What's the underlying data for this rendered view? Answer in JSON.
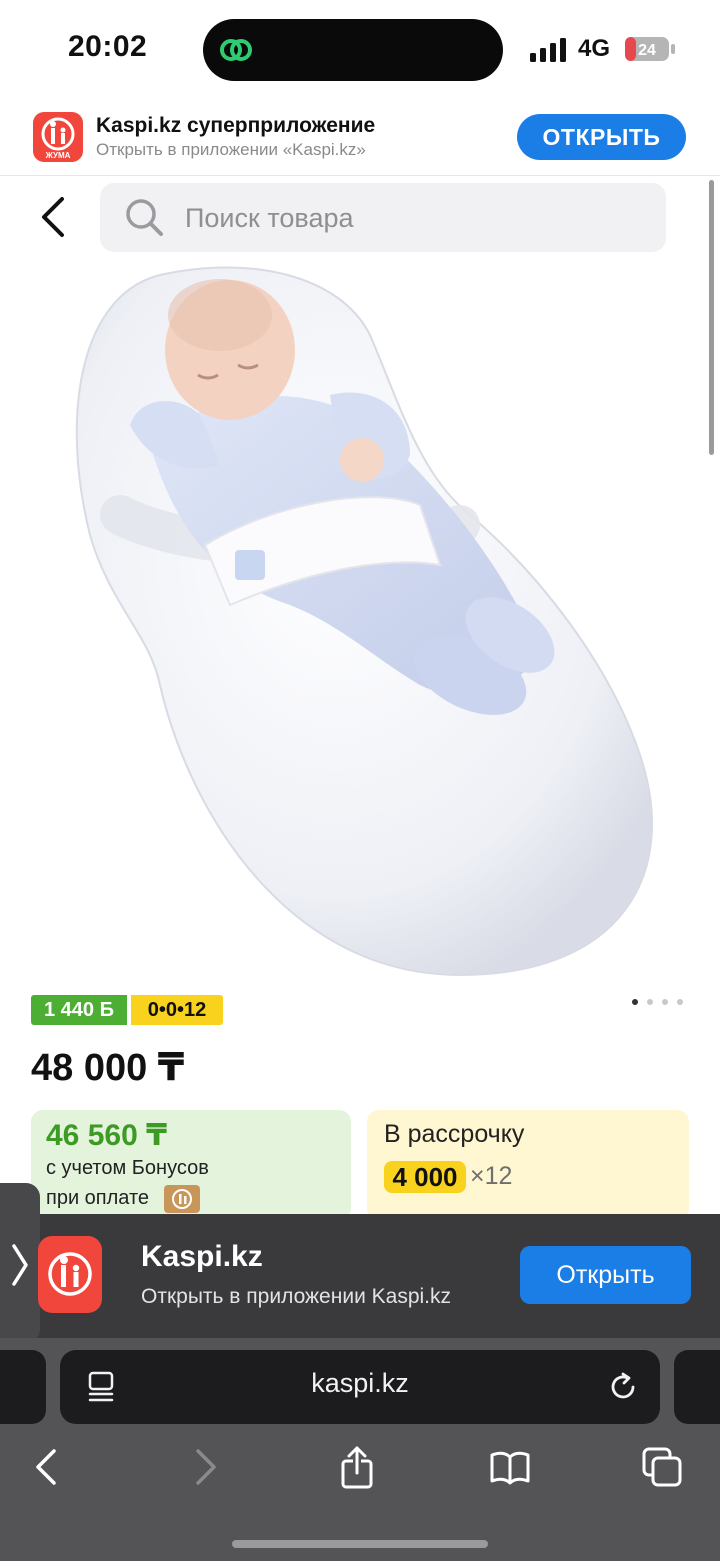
{
  "status_bar": {
    "time": "20:02",
    "network": "4G",
    "battery": "24"
  },
  "smart_banner": {
    "logo_text": "ЖУМА",
    "title": "Kaspi.kz суперприложение",
    "subtitle": "Открыть в приложении «Kaspi.kz»",
    "open_label": "ОТКРЫТЬ"
  },
  "header": {
    "search_placeholder": "Поиск товара"
  },
  "product": {
    "bonus_badge": "1 440 Б",
    "plan_badge": "0•0•12",
    "price": "48 000 ₸",
    "bonus_card": {
      "price": "46 560 ₸",
      "line1": "с учетом Бонусов",
      "line2": "при оплате"
    },
    "installment_card": {
      "label": "В рассрочку",
      "amount": "4 000",
      "times": "×12"
    }
  },
  "app_banner": {
    "title": "Kaspi.kz",
    "subtitle": "Открыть в приложении Kaspi.kz",
    "open_label": "Открыть"
  },
  "browser": {
    "url": "kaspi.kz"
  },
  "colors": {
    "accent_blue": "#1a7ee6",
    "kaspi_red": "#f0463c",
    "bonus_green": "#4cae32",
    "plan_yellow": "#f8d21c"
  }
}
